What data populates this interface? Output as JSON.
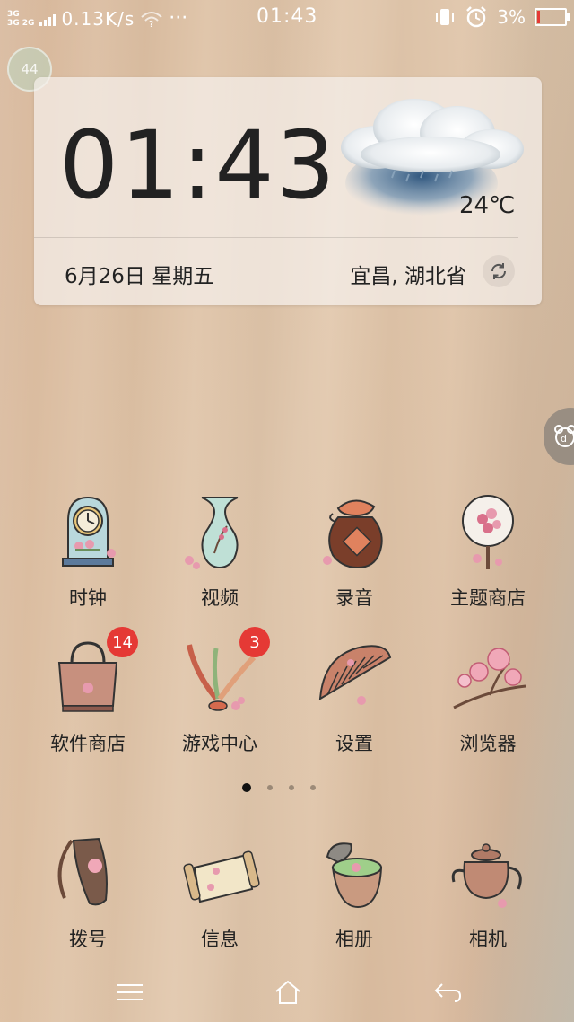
{
  "status_bar": {
    "net_type_top": "3G",
    "net_type_bottom": "3G 2G",
    "net_speed": "0.13K/s",
    "more": "···",
    "clock": "01:43",
    "battery_pct": "3%",
    "battery_level": 0.03,
    "battery_color": "#e53935"
  },
  "fps_badge": "44",
  "widget": {
    "time": "01:43",
    "temperature": "24℃",
    "date": "6月26日 星期五",
    "location": "宜昌, 湖北省",
    "weather_icon": "rain-cloud-icon"
  },
  "apps_row1": [
    {
      "label": "时钟",
      "icon": "clock-icon"
    },
    {
      "label": "视频",
      "icon": "vase-icon"
    },
    {
      "label": "录音",
      "icon": "wine-jar-icon"
    },
    {
      "label": "主题商店",
      "icon": "round-fan-icon"
    }
  ],
  "apps_row2": [
    {
      "label": "软件商店",
      "icon": "handbag-icon",
      "badge": "14"
    },
    {
      "label": "游戏中心",
      "icon": "shuttlecock-icon",
      "badge": "3"
    },
    {
      "label": "设置",
      "icon": "comb-icon"
    },
    {
      "label": "浏览器",
      "icon": "flower-branch-icon"
    }
  ],
  "dock": [
    {
      "label": "拨号",
      "icon": "whistle-icon"
    },
    {
      "label": "信息",
      "icon": "scroll-icon"
    },
    {
      "label": "相册",
      "icon": "tea-bowl-icon"
    },
    {
      "label": "相机",
      "icon": "teapot-icon"
    }
  ],
  "page_indicator": {
    "pages": 4,
    "active": 0
  },
  "colors": {
    "badge": "#e53935",
    "text": "#222222"
  }
}
